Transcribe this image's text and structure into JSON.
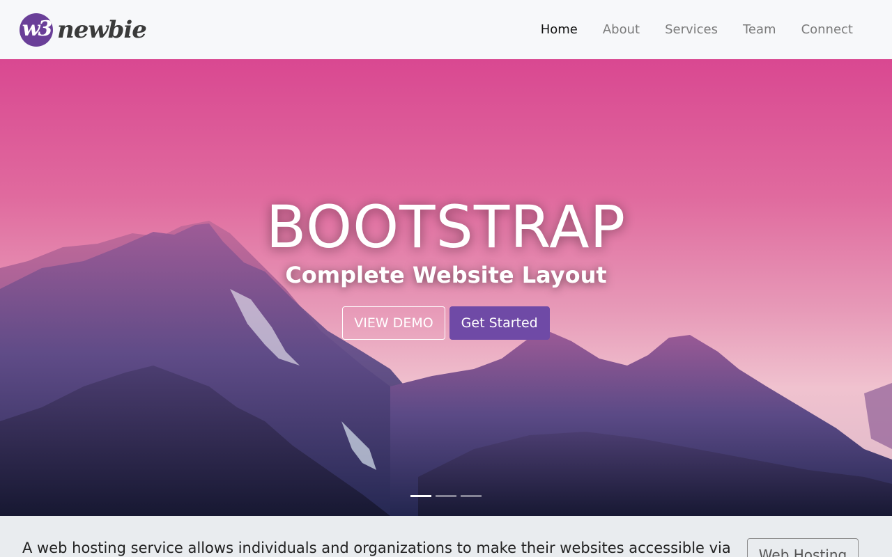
{
  "brand": {
    "mark_text": "w3",
    "name": "newbie",
    "mark_color": "#6a3f98"
  },
  "nav": {
    "items": [
      {
        "label": "Home",
        "active": true
      },
      {
        "label": "About",
        "active": false
      },
      {
        "label": "Services",
        "active": false
      },
      {
        "label": "Team",
        "active": false
      },
      {
        "label": "Connect",
        "active": false
      }
    ]
  },
  "hero": {
    "title": "BOOTSTRAP",
    "subtitle": "Complete Website Layout",
    "view_demo_label": "VIEW DEMO",
    "get_started_label": "Get Started",
    "accent_color": "#6f4aa6",
    "slides_total": 3,
    "active_slide": 1
  },
  "jumbotron": {
    "text": "A web hosting service allows individuals and organizations to make their websites accessible via",
    "button_label": "Web Hosting"
  }
}
